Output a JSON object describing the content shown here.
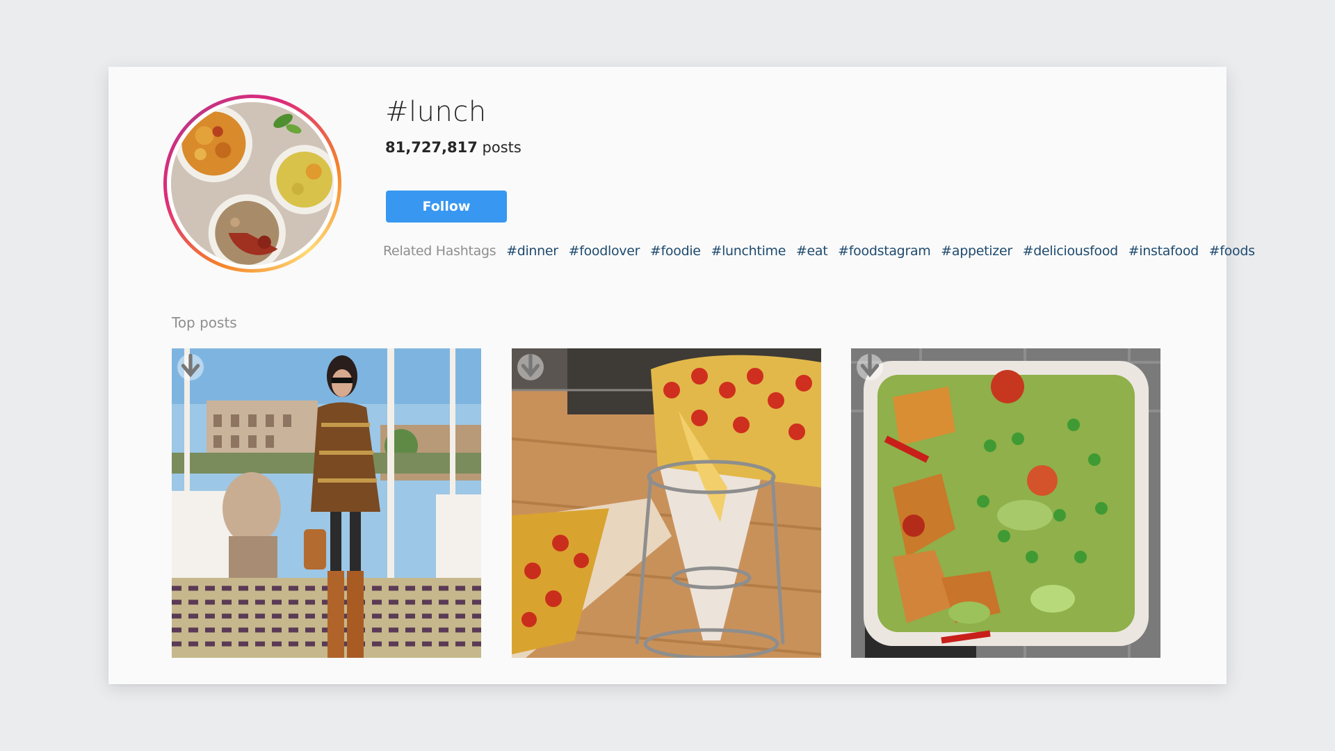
{
  "hashtag": {
    "title": "#lunch",
    "post_count": "81,727,817",
    "posts_label": "posts",
    "follow_label": "Follow"
  },
  "related": {
    "label": "Related Hashtags",
    "tags": [
      "#dinner",
      "#foodlover",
      "#foodie",
      "#lunchtime",
      "#eat",
      "#foodstagram",
      "#appetizer",
      "#deliciousfood",
      "#instafood",
      "#foods"
    ]
  },
  "top_posts": {
    "title": "Top posts",
    "items": [
      {
        "icon": "download-icon"
      },
      {
        "icon": "download-icon"
      },
      {
        "icon": "download-icon"
      }
    ]
  },
  "colors": {
    "follow_button": "#3897f0",
    "hashtag_link": "#1e4a6e",
    "page_background": "#ebecee",
    "card_background": "#fafafa"
  }
}
